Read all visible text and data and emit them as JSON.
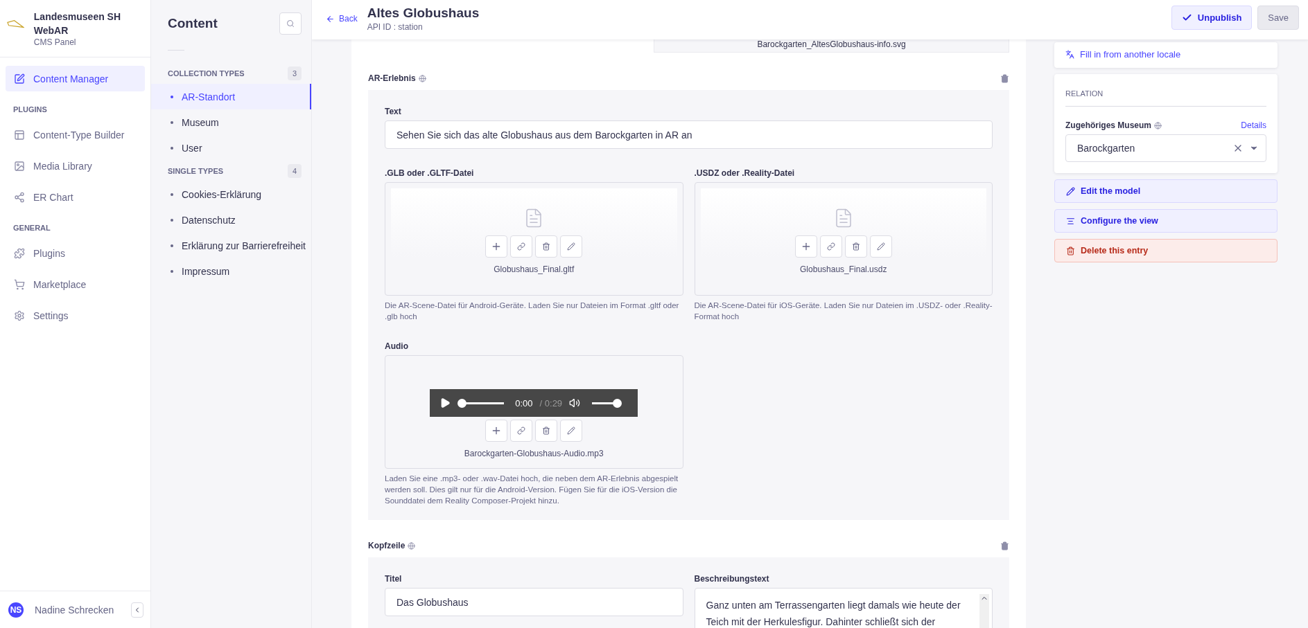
{
  "brand": {
    "title": "Landesmuseen SH WebAR",
    "subtitle": "CMS Panel"
  },
  "main_nav": {
    "top": [
      {
        "label": "Content Manager",
        "selected": true
      }
    ],
    "groups": [
      {
        "heading": "PLUGINS",
        "items": [
          {
            "label": "Content-Type Builder",
            "selected": false
          },
          {
            "label": "Media Library",
            "selected": false
          },
          {
            "label": "ER Chart",
            "selected": false
          }
        ]
      },
      {
        "heading": "GENERAL",
        "items": [
          {
            "label": "Plugins",
            "selected": false
          },
          {
            "label": "Marketplace",
            "selected": false
          },
          {
            "label": "Settings",
            "selected": false
          }
        ]
      }
    ]
  },
  "user": {
    "initials": "NS",
    "name": "Nadine Schrecken"
  },
  "content_nav": {
    "title": "Content",
    "groups": [
      {
        "heading": "COLLECTION TYPES",
        "count": "3",
        "items": [
          {
            "label": "AR-Standort",
            "selected": true
          },
          {
            "label": "Museum",
            "selected": false
          },
          {
            "label": "User",
            "selected": false
          }
        ]
      },
      {
        "heading": "SINGLE TYPES",
        "count": "4",
        "items": [
          {
            "label": "Cookies-Erklärung",
            "selected": false
          },
          {
            "label": "Datenschutz",
            "selected": false
          },
          {
            "label": "Erklärung zur Barrierefreiheit",
            "selected": false
          },
          {
            "label": "Impressum",
            "selected": false
          }
        ]
      }
    ]
  },
  "header": {
    "back": "Back",
    "title": "Altes Globushaus",
    "subtitle": "API ID : station",
    "buttons": [
      {
        "label": "Unpublish",
        "kind": "primary"
      },
      {
        "label": "Save",
        "kind": "disabled"
      }
    ]
  },
  "previous_file": "Barockgarten_AltesGlobushaus-info.svg",
  "components": [
    {
      "title": "AR-Erlebnis",
      "fields": [
        {
          "kind": "text",
          "label": "Text",
          "value": "Sehen Sie sich das alte Globushaus aus dem Barockgarten in AR an",
          "full_width": true
        },
        {
          "kind": "media",
          "label": ".GLB oder .GLTF-Datei",
          "file": "Globushaus_Final.gltf",
          "hint": "Die AR-Scene-Datei für Android-Geräte. Laden Sie nur Dateien im Format .gltf oder .glb hoch"
        },
        {
          "kind": "media",
          "label": ".USDZ oder .Reality-Datei",
          "file": "Globushaus_Final.usdz",
          "hint": "Die AR-Scene-Datei für iOS-Geräte. Laden Sie nur Dateien im .USDZ- oder .Reality-Format hoch"
        },
        {
          "kind": "audio",
          "label": "Audio",
          "file": "Barockgarten-Globushaus-Audio.mp3",
          "time": "0:00",
          "duration": "/ 0:29",
          "playback": {
            "level": 0
          },
          "volume": {
            "level": 1
          },
          "hint": "Laden Sie eine .mp3- oder .wav-Datei hoch, die neben dem AR-Erlebnis abgespielt werden soll. Dies gilt nur für die Android-Version. Fügen Sie für die iOS-Version die Sounddatei dem Reality Composer-Projekt hinzu."
        }
      ]
    },
    {
      "title": "Kopfzeile",
      "fields": [
        {
          "kind": "text",
          "label": "Titel",
          "value": "Das Globushaus",
          "full_width": false
        },
        {
          "kind": "textarea",
          "label": "Beschreibungstext",
          "value": "Ganz unten am Terrassengarten liegt damals wie heute der Teich mit der Herkulesfigur. Dahinter schließt sich der"
        }
      ]
    }
  ],
  "side": {
    "locale_link": "Fill in from another locale",
    "relation": {
      "heading": "RELATION",
      "label": "Zugehöriges Museum",
      "details": "Details",
      "value": "Barockgarten"
    },
    "actions": [
      {
        "label": "Edit the model",
        "kind": "edit"
      },
      {
        "label": "Configure the view",
        "kind": "configure"
      },
      {
        "label": "Delete this entry",
        "kind": "delete"
      }
    ]
  }
}
